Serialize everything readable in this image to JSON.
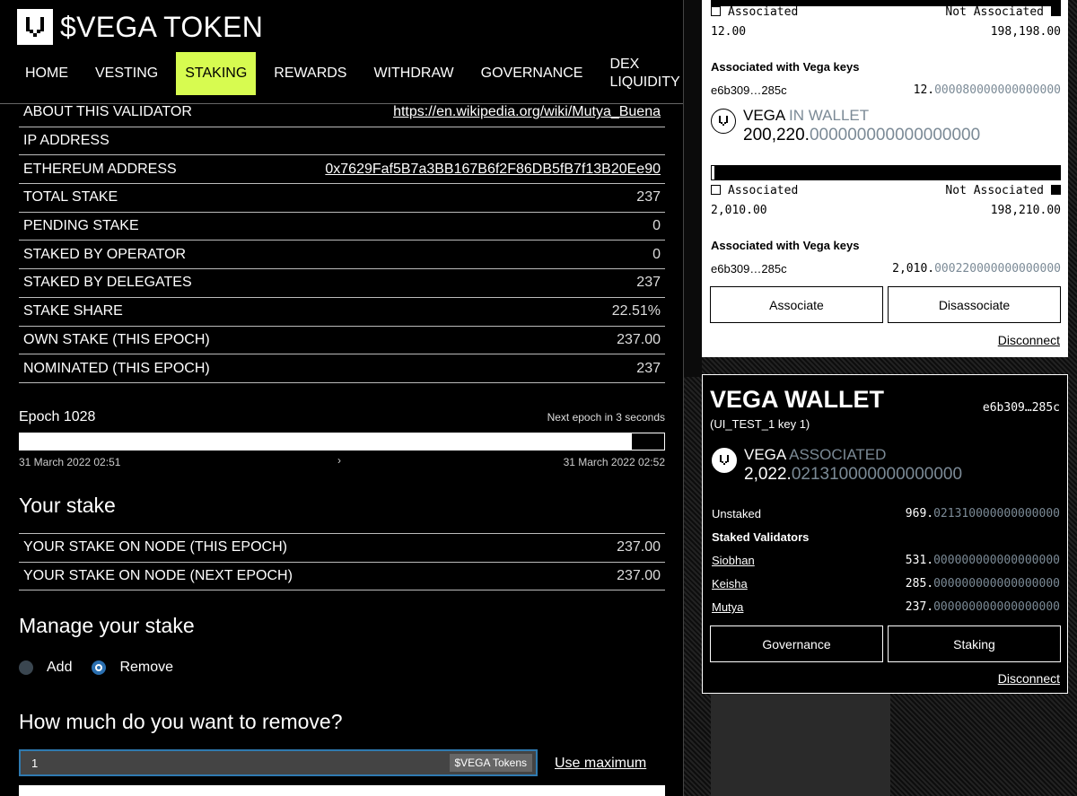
{
  "app": {
    "title": "$VEGA TOKEN"
  },
  "nav": {
    "items": [
      "HOME",
      "VESTING",
      "STAKING",
      "REWARDS",
      "WITHDRAW",
      "GOVERNANCE",
      "DEX LIQUIDITY"
    ],
    "active": "STAKING",
    "active_color": "#d7fb50"
  },
  "validator": {
    "rows": [
      {
        "key": "ABOUT THIS VALIDATOR",
        "value": "https://en.wikipedia.org/wiki/Mutya_Buena",
        "link": true
      },
      {
        "key": "IP ADDRESS",
        "value": ""
      },
      {
        "key": "ETHEREUM ADDRESS",
        "value": "0x7629Faf5B7a3BB167B6f2F86DB5fB7f13B20Ee90",
        "link": true
      },
      {
        "key": "TOTAL STAKE",
        "value": "237"
      },
      {
        "key": "PENDING STAKE",
        "value": "0"
      },
      {
        "key": "STAKED BY OPERATOR",
        "value": "0"
      },
      {
        "key": "STAKED BY DELEGATES",
        "value": "237"
      },
      {
        "key": "STAKE SHARE",
        "value": "22.51%"
      },
      {
        "key": "OWN STAKE (THIS EPOCH)",
        "value": "237.00"
      },
      {
        "key": "NOMINATED (THIS EPOCH)",
        "value": "237"
      }
    ]
  },
  "epoch": {
    "label": "Epoch 1028",
    "next": "Next epoch in 3 seconds",
    "progress": 0.95,
    "start": "31 March 2022 02:51",
    "end": "31 March 2022 02:52"
  },
  "your_stake": {
    "title": "Your stake",
    "rows": [
      {
        "key": "YOUR STAKE ON NODE (THIS EPOCH)",
        "value": "237.00"
      },
      {
        "key": "YOUR STAKE ON NODE (NEXT EPOCH)",
        "value": "237.00"
      }
    ]
  },
  "manage": {
    "title": "Manage your stake",
    "add_label": "Add",
    "remove_label": "Remove",
    "selected": "Remove",
    "amount_title": "How much do you want to remove?",
    "amount_value": "1",
    "unit": "$VEGA Tokens",
    "use_max": "Use maximum"
  },
  "eth_panel": {
    "bar1": {
      "associated_fraction": 0.0
    },
    "assoc1": {
      "associated_label": "Associated",
      "not_associated_label": "Not Associated",
      "associated_value": "12.00",
      "not_associated_value": "198,198.00"
    },
    "keys_title_1": "Associated with Vega keys",
    "key1": {
      "key": "e6b309…285c",
      "value_main": "12.",
      "value_frac": "000080000000000000"
    },
    "wallet_token": {
      "name": "VEGA",
      "tag": "IN WALLET",
      "amount_main": "200,220.",
      "amount_frac": "000000000000000000"
    },
    "bar2": {
      "associated_fraction": 0.01
    },
    "assoc2": {
      "associated_label": "Associated",
      "not_associated_label": "Not Associated",
      "associated_value": "2,010.00",
      "not_associated_value": "198,210.00"
    },
    "keys_title_2": "Associated with Vega keys",
    "key2": {
      "key": "e6b309…285c",
      "value_main": "2,010.",
      "value_frac": "000220000000000000"
    },
    "associate_button": "Associate",
    "disassociate_button": "Disassociate",
    "disconnect": "Disconnect"
  },
  "vega_wallet": {
    "title": "VEGA WALLET",
    "key": "e6b309…285c",
    "name": "(UI_TEST_1 key 1)",
    "token": {
      "name": "VEGA",
      "tag": "ASSOCIATED",
      "amount_main": "2,022.",
      "amount_frac": "021310000000000000"
    },
    "unstaked_label": "Unstaked",
    "unstaked_main": "969.",
    "unstaked_frac": "021310000000000000",
    "staked_title": "Staked Validators",
    "validators": [
      {
        "name": "Siobhan",
        "main": "531.",
        "frac": "000000000000000000"
      },
      {
        "name": "Keisha",
        "main": "285.",
        "frac": "000000000000000000"
      },
      {
        "name": "Mutya",
        "main": "237.",
        "frac": "000000000000000000"
      }
    ],
    "governance_button": "Governance",
    "staking_button": "Staking",
    "disconnect": "Disconnect"
  }
}
